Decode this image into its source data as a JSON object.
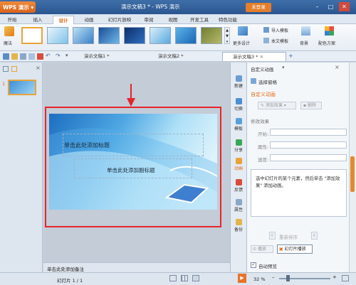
{
  "window": {
    "app_button": "WPS 演示",
    "title": "演示文稿3 * - WPS 演示",
    "login_label": "未登录",
    "minimize_icon": "minimize-icon",
    "maximize_icon": "maximize-icon",
    "close_icon": "close-icon"
  },
  "ribbon_tabs": [
    "开始",
    "插入",
    "设计",
    "动画",
    "幻灯片放映",
    "审阅",
    "视图",
    "开发工具",
    "特色功能"
  ],
  "ribbon": {
    "magic_label": "魔法",
    "more_design_label": "更多设计",
    "import_template_label": "导入模板",
    "text_template_label": "本文模板",
    "background_label": "背景",
    "color_scheme_label": "配色方案"
  },
  "doc_tabs": [
    "演示文稿1 *",
    "演示文稿2 *",
    "演示文稿3 *"
  ],
  "slide_panel": {
    "slide_number": "1"
  },
  "slide": {
    "title_placeholder": "单击此处添加标题",
    "subtitle_placeholder": "单击此处添加副标题"
  },
  "notes_placeholder": "单击此处添加备注",
  "side_strip": [
    "新建",
    "切换",
    "模板",
    "分享",
    "动画",
    "反馈",
    "属性",
    "备份"
  ],
  "task_pane": {
    "header": "自定义动画",
    "select_pane": "选择窗格",
    "section_title": "自定义动画",
    "add_effect": "添加效果",
    "delete": "删除",
    "modify_effect": "修改效果",
    "start_label": "开始:",
    "property_label": "属性:",
    "speed_label": "速度:",
    "hint": "选中幻灯片的某个元素，然后单击 \"添加效果\" 添加动画。",
    "reorder": "重新排序",
    "play": "播放",
    "slideshow": "幻灯片播放",
    "autopreview": "自动预览"
  },
  "status": {
    "slide_counter": "幻灯片 1 / 1",
    "zoom": "32 %"
  },
  "colors": {
    "accent_orange": "#e06a14",
    "title_blue": "#2a5690",
    "highlight_red": "#e6252b"
  }
}
